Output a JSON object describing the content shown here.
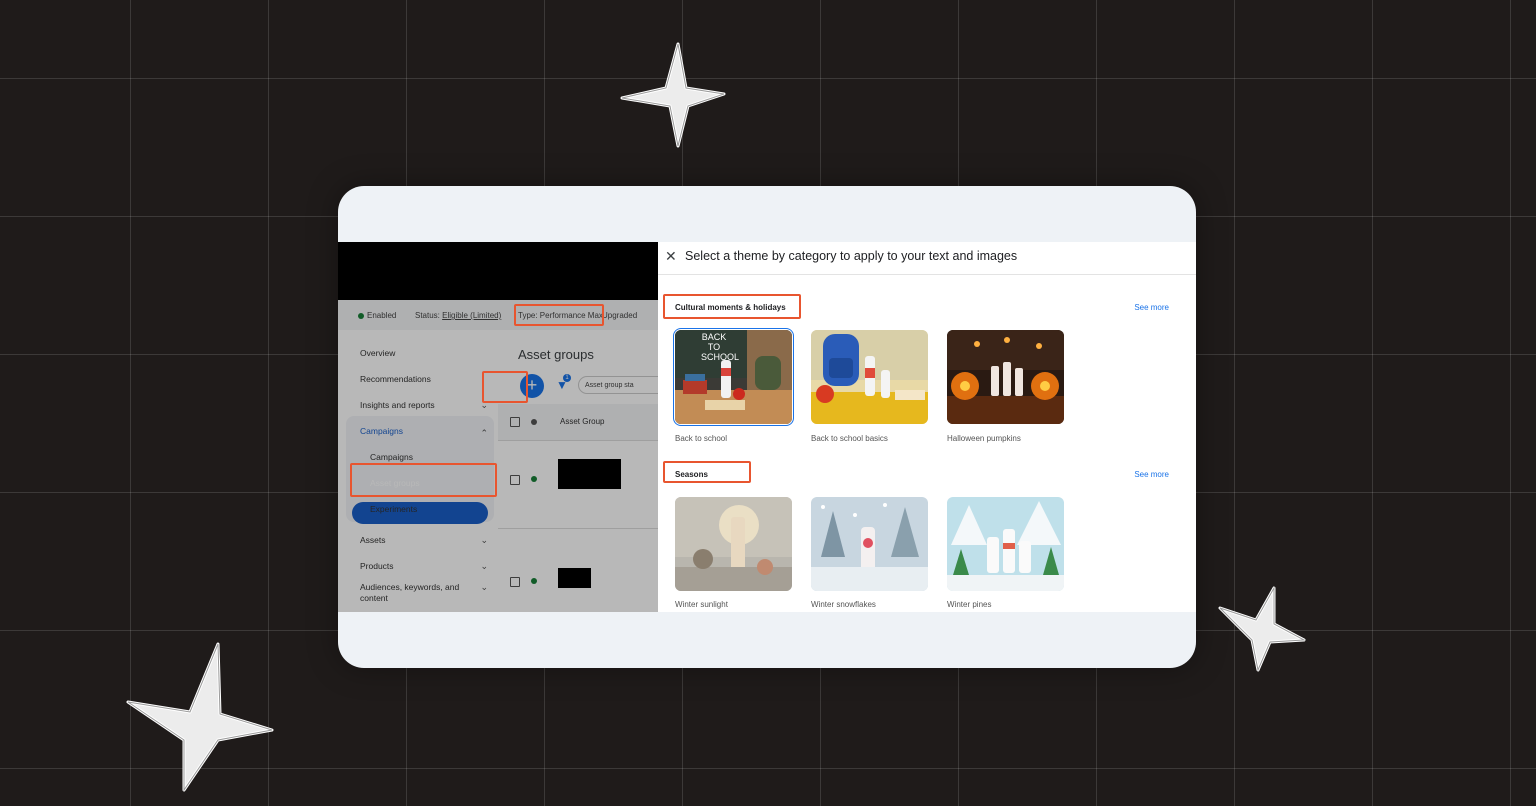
{
  "app": {
    "status": {
      "enabled": "Enabled",
      "status_prefix": "Status:",
      "status_value": "Eligible (Limited)",
      "type": "Type: Performance Max",
      "upgraded": "Upgraded"
    },
    "nav": {
      "overview": "Overview",
      "recommendations": "Recommendations",
      "insights": "Insights and reports",
      "campaigns_group": "Campaigns",
      "campaigns": "Campaigns",
      "asset_groups": "Asset groups",
      "experiments": "Experiments",
      "assets": "Assets",
      "products": "Products",
      "audiences_line1": "Audiences, keywords, and",
      "audiences_line2": "content"
    },
    "main": {
      "title": "Asset groups",
      "filter_badge": "1",
      "search_chip": "Asset group sta",
      "col_asset_group": "Asset Group"
    }
  },
  "theme_panel": {
    "title": "Select a theme by category to apply to your text and images",
    "sections": [
      {
        "title": "Cultural moments & holidays",
        "see_more": "See more",
        "items": [
          {
            "label": "Back to school",
            "image_text": "BACK TO SCHOOL"
          },
          {
            "label": "Back to school basics"
          },
          {
            "label": "Halloween pumpkins"
          }
        ]
      },
      {
        "title": "Seasons",
        "see_more": "See more",
        "items": [
          {
            "label": "Winter sunlight"
          },
          {
            "label": "Winter snowflakes"
          },
          {
            "label": "Winter pines"
          }
        ]
      }
    ]
  },
  "colors": {
    "background": "#1f1b1a",
    "card": "#eef2f6",
    "highlight": "#e8552f",
    "accent": "#1a73e8",
    "nav_active": "#1a5fc8",
    "enabled_dot": "#188038"
  }
}
